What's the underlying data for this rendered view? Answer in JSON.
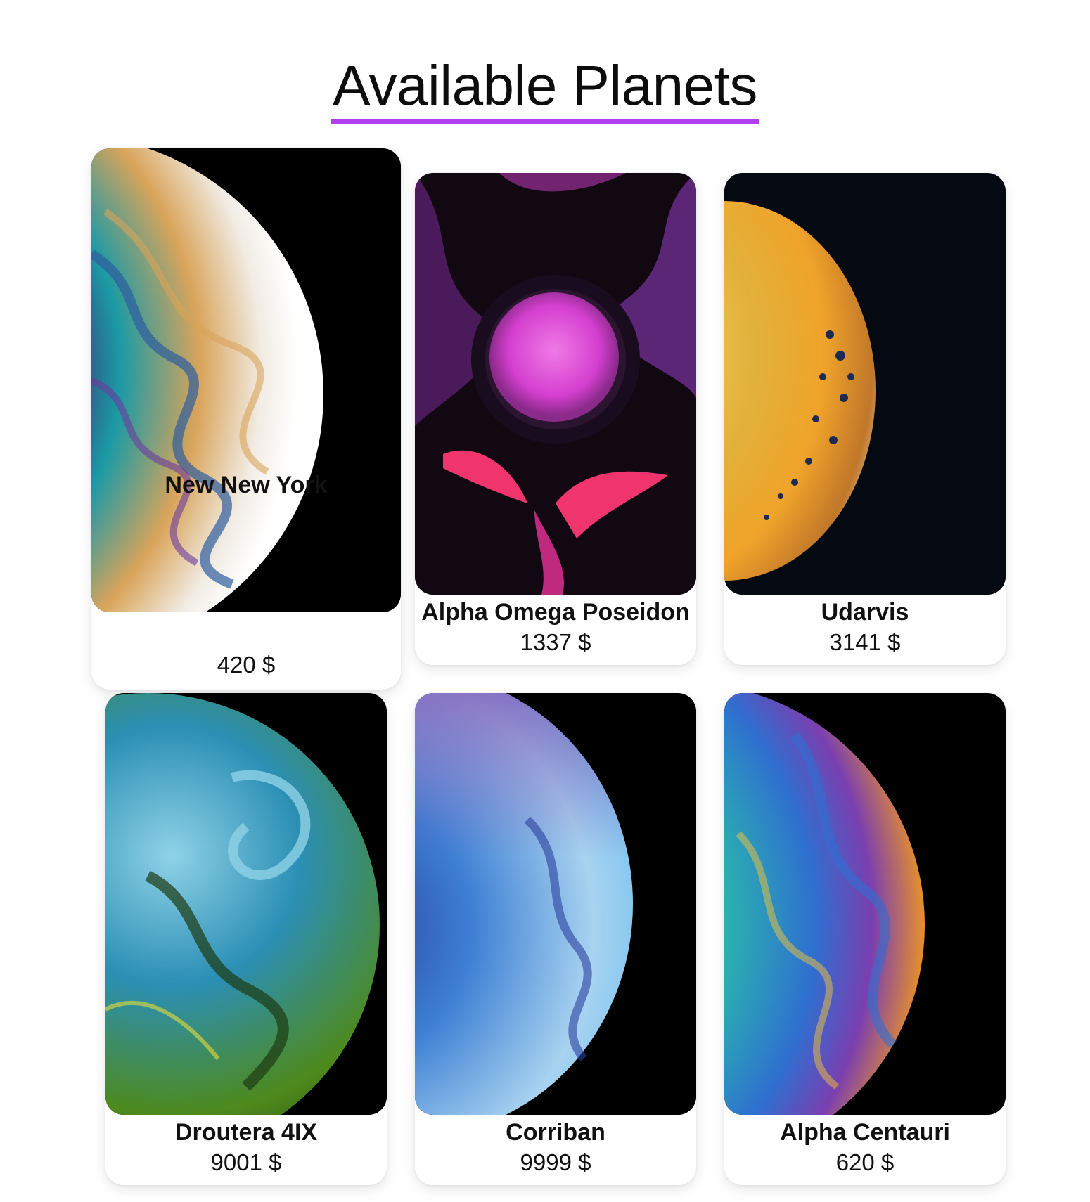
{
  "header": {
    "title": "Available Planets",
    "accent_color": "#b13ff0"
  },
  "planets": [
    {
      "name": "New New York",
      "price": "420 $",
      "palette": [
        "#2d5d9e",
        "#d9a45a",
        "#f1ece4",
        "#3b2a6e",
        "#1b9aa5"
      ]
    },
    {
      "name": "Alpha Omega Poseidon",
      "price": "1337 $",
      "palette": [
        "#d43fcf",
        "#5a1f6e",
        "#f0356e",
        "#1a0c1f",
        "#8a3bb8"
      ]
    },
    {
      "name": "Udarvis",
      "price": "3141 $",
      "palette": [
        "#e2b13a",
        "#f0a32a",
        "#e8e2d2",
        "#1d2a52",
        "#c0772a"
      ]
    },
    {
      "name": "Droutera 4IX",
      "price": "9001 $",
      "palette": [
        "#2b8fb5",
        "#4e8a1c",
        "#8fd2e6",
        "#1d3a12",
        "#e6de3a"
      ]
    },
    {
      "name": "Corriban",
      "price": "9999 $",
      "palette": [
        "#3d7fd4",
        "#7d4fb2",
        "#a8d3f0",
        "#2b3f9e",
        "#5ab8ef"
      ]
    },
    {
      "name": "Alpha Centauri",
      "price": "620 $",
      "palette": [
        "#e8902a",
        "#2f6fd0",
        "#f2c33a",
        "#7a3fb0",
        "#2ab0b0"
      ]
    }
  ]
}
